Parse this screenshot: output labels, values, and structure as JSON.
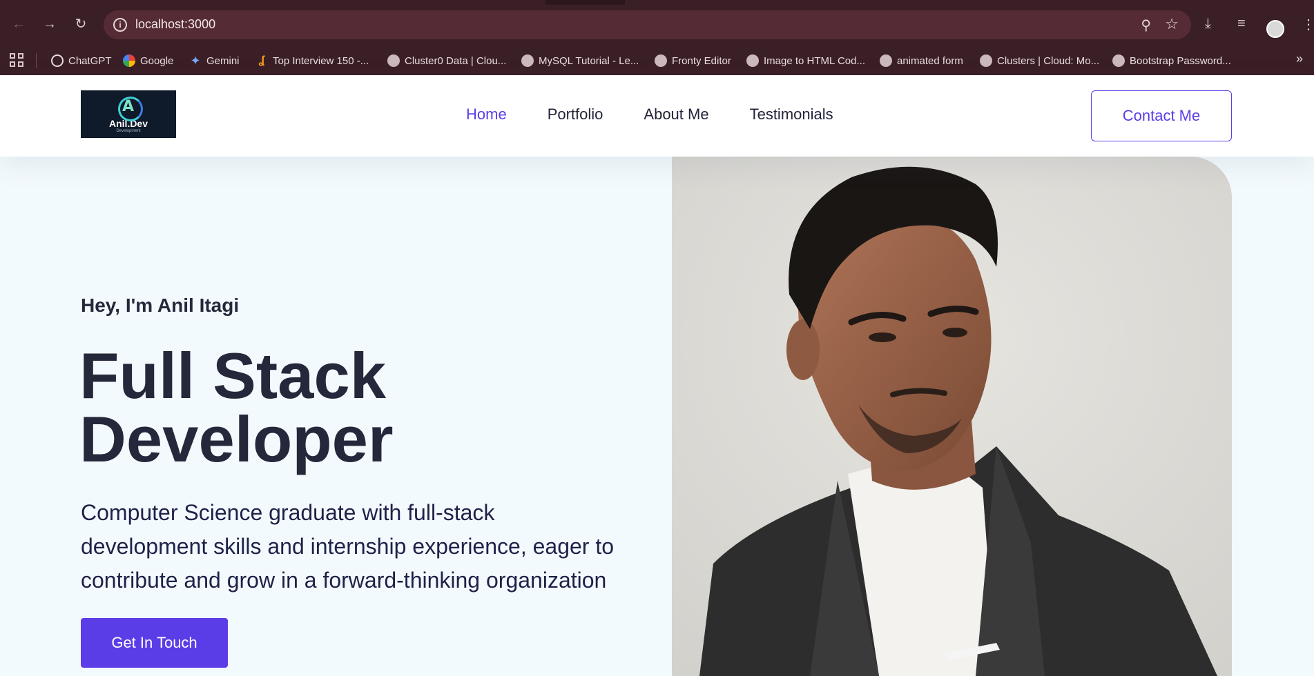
{
  "browser": {
    "url": "localhost:3000",
    "bookmarks": [
      {
        "label": "ChatGPT",
        "icon": "chatgpt-icon"
      },
      {
        "label": "Google",
        "icon": "google-icon"
      },
      {
        "label": "Gemini",
        "icon": "gemini-icon"
      },
      {
        "label": "Top Interview 150 -...",
        "icon": "leetcode-icon"
      },
      {
        "label": "Cluster0 Data | Clou...",
        "icon": "globe-icon"
      },
      {
        "label": "MySQL Tutorial - Le...",
        "icon": "globe-icon"
      },
      {
        "label": "Fronty Editor",
        "icon": "globe-icon"
      },
      {
        "label": "Image to HTML Cod...",
        "icon": "globe-icon"
      },
      {
        "label": "animated form",
        "icon": "globe-icon"
      },
      {
        "label": "Clusters | Cloud: Mo...",
        "icon": "globe-icon"
      },
      {
        "label": "Bootstrap Password...",
        "icon": "globe-icon"
      }
    ]
  },
  "site": {
    "logo": {
      "text": "Anil.Dev",
      "subtext": "Development"
    },
    "nav": {
      "items": [
        {
          "label": "Home",
          "active": true
        },
        {
          "label": "Portfolio",
          "active": false
        },
        {
          "label": "About Me",
          "active": false
        },
        {
          "label": "Testimonials",
          "active": false
        }
      ],
      "contact_label": "Contact Me"
    },
    "hero": {
      "greeting": "Hey, I'm Anil Itagi",
      "title_line1": "Full Stack",
      "title_line2": "Developer",
      "description_line1": "Computer Science graduate with full-stack",
      "description_line2": "development skills and internship experience, eager to",
      "description_line3": "contribute and grow in a forward-thinking organization",
      "cta_label": "Get In Touch"
    }
  },
  "colors": {
    "accent": "#5b3de8",
    "heading": "#25283b",
    "hero_bg": "#f3fafd",
    "browser_frame": "#3b1f26"
  }
}
